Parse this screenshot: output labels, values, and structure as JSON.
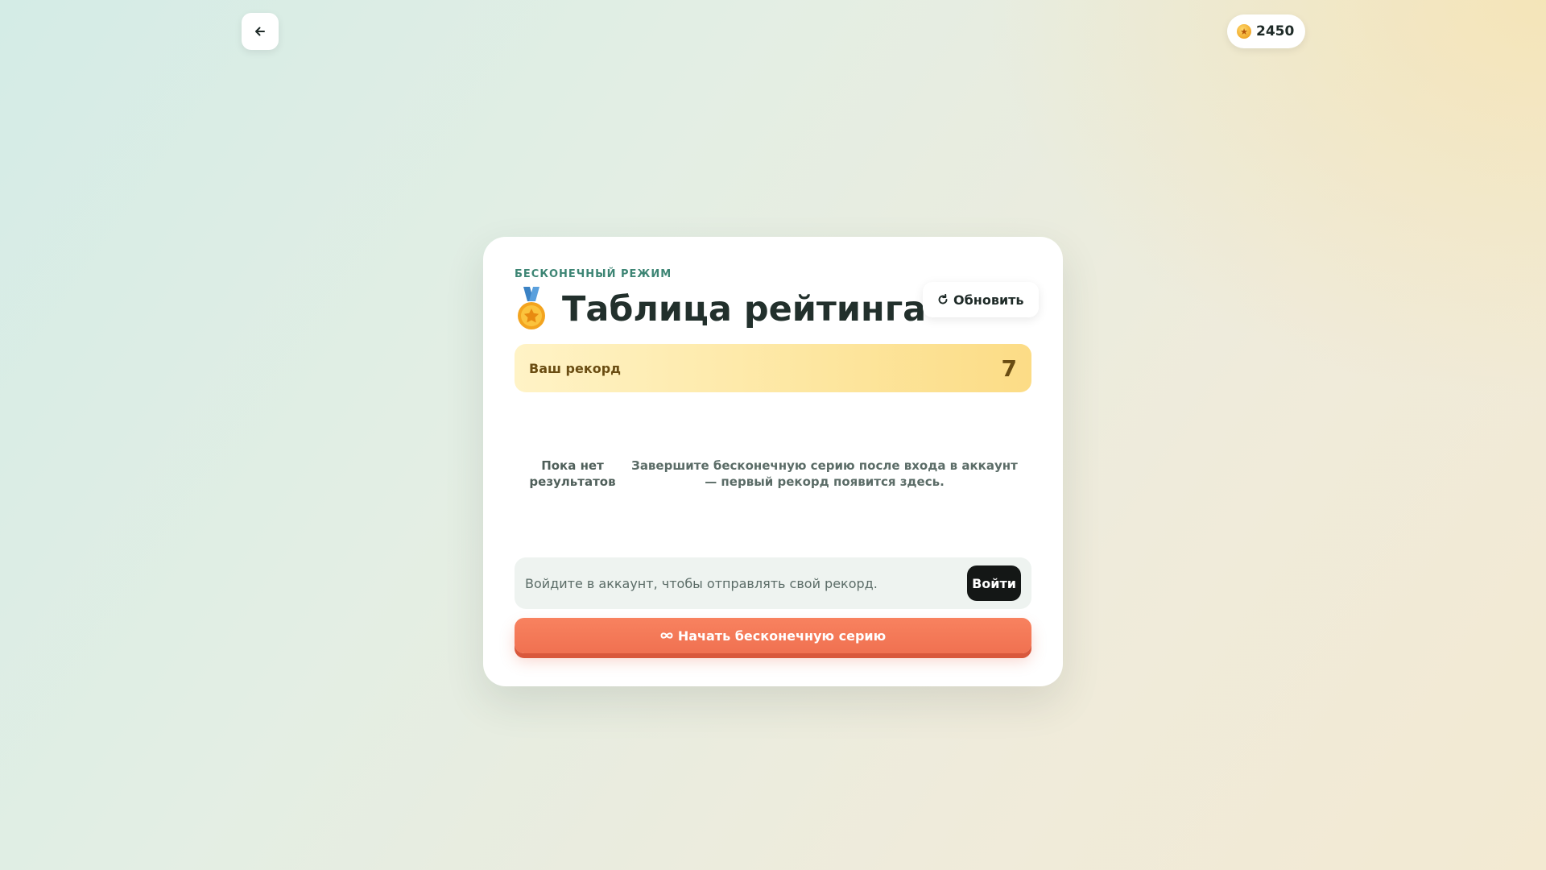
{
  "header": {
    "back_icon": "arrow-left-icon",
    "coins": "2450",
    "coin_icon": "coin-icon"
  },
  "card": {
    "eyebrow": "БЕСКОНЕЧНЫЙ РЕЖИМ",
    "title": "Таблица рейтинга",
    "title_icon": "medal-icon",
    "refresh_icon": "refresh-icon",
    "refresh_label": "Обновить",
    "record_label": "Ваш рекорд",
    "record_value": "7",
    "empty_title": "Пока нет результатов",
    "empty_text": "Завершите бесконечную серию после входа в аккаунт — первый рекорд появится здесь.",
    "login_text": "Войдите в аккаунт, чтобы отправлять свой рекорд.",
    "login_button": "Войти",
    "start_icon": "infinity-icon",
    "start_button": "Начать бесконечную серию"
  },
  "colors": {
    "accent": "#f07151",
    "eyebrow": "#3d8574",
    "record_bg": "#fde69f",
    "login_btn": "#141716"
  }
}
